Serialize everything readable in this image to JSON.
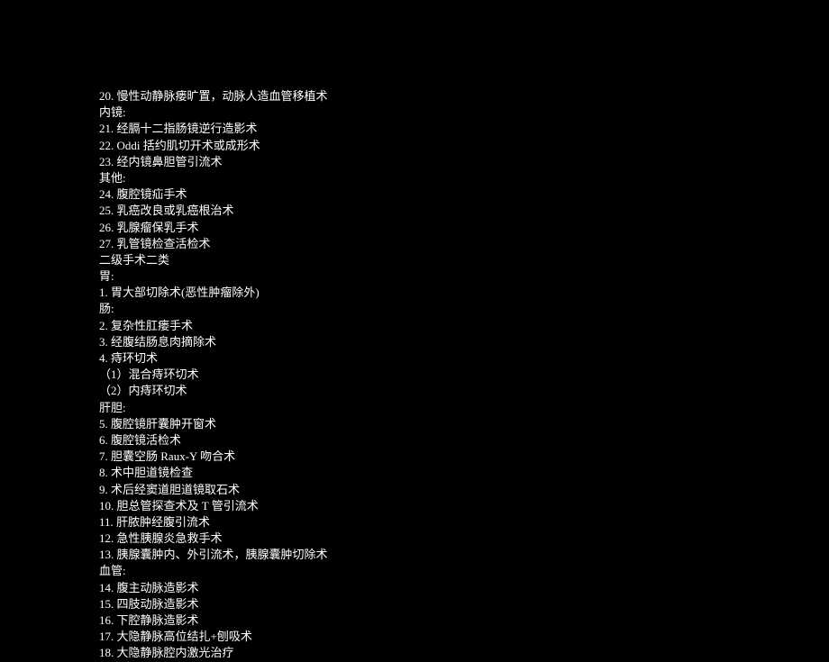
{
  "lines": [
    "20. 慢性动静脉瘘旷置，动脉人造血管移植术",
    "内镜:",
    "21. 经膈十二指肠镜逆行造影术",
    "22. Oddi 括约肌切开术或成形术",
    "23. 经内镜鼻胆管引流术",
    "其他:",
    "24. 腹腔镜疝手术",
    "25. 乳癌改良或乳癌根治术",
    "26. 乳腺瘤保乳手术",
    "27. 乳管镜检查活检术",
    "二级手术二类",
    "胃:",
    "1. 胃大部切除术(恶性肿瘤除外)",
    "肠:",
    "2. 复杂性肛瘘手术",
    "3. 经腹结肠息肉摘除术",
    "4. 痔环切术",
    "（1）混合痔环切术",
    "（2）内痔环切术",
    "肝胆:",
    "5. 腹腔镜肝囊肿开窗术",
    "6. 腹腔镜活检术",
    "7. 胆囊空肠 Raux-Y 吻合术",
    "8. 术中胆道镜检查",
    "9. 术后经窦道胆道镜取石术",
    "10. 胆总管探查术及 T 管引流术",
    "11. 肝脓肿经腹引流术",
    "12. 急性胰腺炎急救手术",
    "13. 胰腺囊肿内、外引流术，胰腺囊肿切除术",
    "血管:",
    "14. 腹主动脉造影术",
    "15. 四肢动脉造影术",
    "16. 下腔静脉造影术",
    "17. 大隐静脉高位结扎+刨吸术",
    "18. 大隐静脉腔内激光治疗"
  ]
}
